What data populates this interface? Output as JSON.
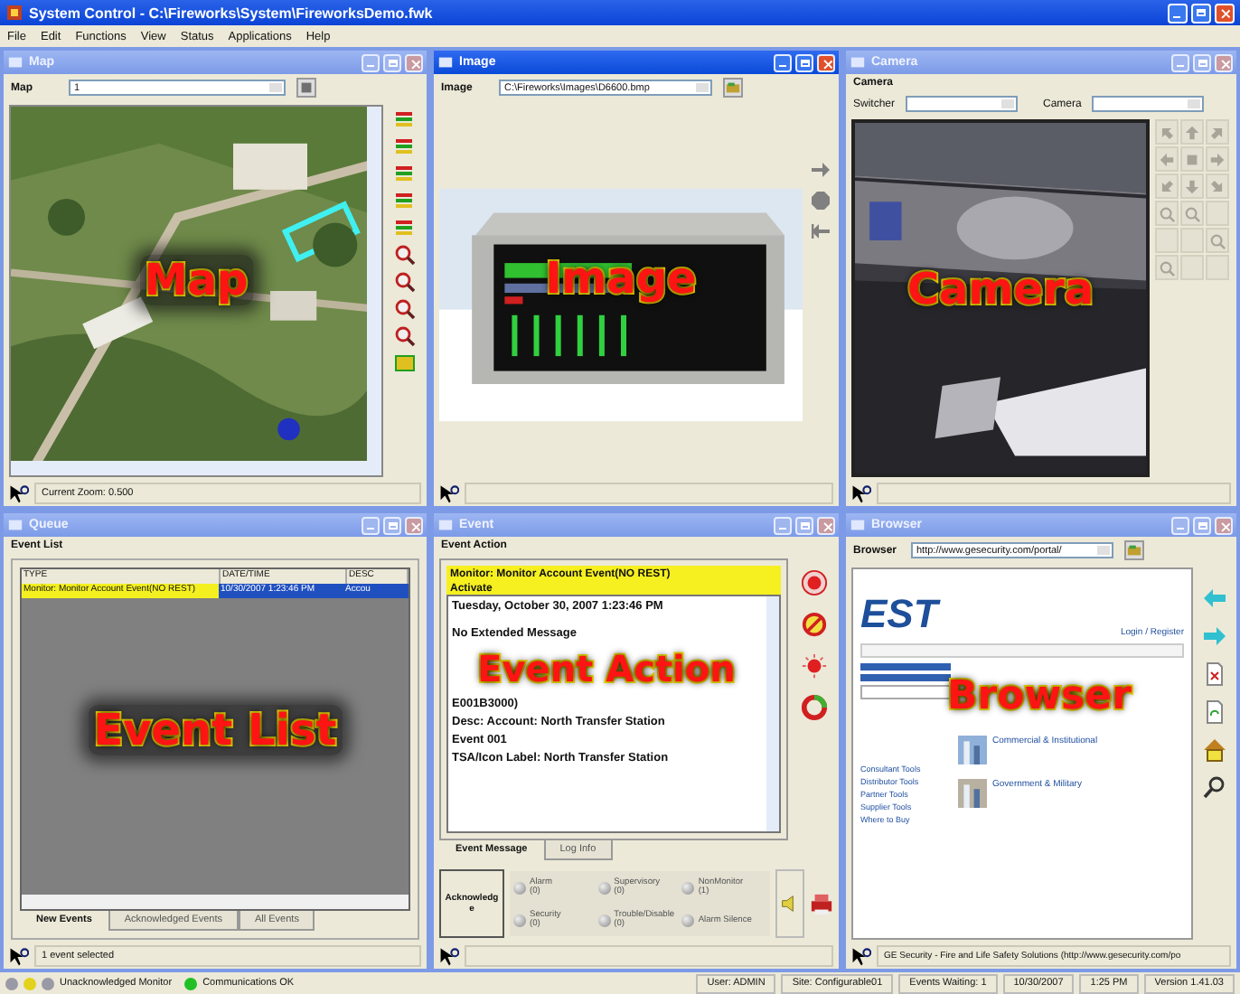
{
  "window": {
    "title": "System Control - C:\\Fireworks\\System\\FireworksDemo.fwk"
  },
  "menu": [
    "File",
    "Edit",
    "Functions",
    "View",
    "Status",
    "Applications",
    "Help"
  ],
  "map": {
    "title": "Map",
    "active": false,
    "label": "Map",
    "value": "1",
    "status": "Current Zoom: 0.500",
    "overlay": "Map"
  },
  "image": {
    "title": "Image",
    "active": true,
    "label": "Image",
    "value": "C:\\Fireworks\\Images\\D6600.bmp",
    "overlay": "Image"
  },
  "camera": {
    "title": "Camera",
    "active": false,
    "section": "Camera",
    "switcher_label": "Switcher",
    "camera_label": "Camera",
    "overlay": "Camera"
  },
  "queue": {
    "title": "Queue",
    "active": false,
    "section": "Event List",
    "columns": [
      "TYPE",
      "DATE/TIME",
      "DESC"
    ],
    "rows": [
      {
        "cells": [
          "Monitor: Monitor Account Event(NO REST)",
          "10/30/2007 1:23:46 PM",
          "Accou"
        ],
        "selected": true
      }
    ],
    "tabs": [
      {
        "label": "New Events",
        "selected": true
      },
      {
        "label": "Acknowledged Events",
        "selected": false
      },
      {
        "label": "All Events",
        "selected": false
      }
    ],
    "status": "1 event selected",
    "overlay": "Event List"
  },
  "event": {
    "title": "Event",
    "active": false,
    "section": "Event Action",
    "header": [
      "Monitor: Monitor Account Event(NO REST)",
      "Activate"
    ],
    "lines": [
      "Tuesday, October 30, 2007 1:23:46 PM",
      "No Extended Message",
      "E001B3000)",
      "Desc: Account: North Transfer Station",
      "Event 001",
      "TSA/Icon Label: North Transfer Station"
    ],
    "tabs": [
      {
        "label": "Event Message",
        "selected": true
      },
      {
        "label": "Log Info",
        "selected": false
      }
    ],
    "acknowledge": "Acknowledge",
    "indicators": [
      {
        "label": "Alarm",
        "count": "(0)"
      },
      {
        "label": "Supervisory",
        "count": "(0)"
      },
      {
        "label": "NonMonitor",
        "count": "(1)"
      },
      {
        "label": "Security",
        "count": "(0)"
      },
      {
        "label": "Trouble/Disable",
        "count": "(0)"
      },
      {
        "label": "Alarm Silence"
      }
    ],
    "overlay": "Event Action"
  },
  "browser": {
    "title": "Browser",
    "active": false,
    "label": "Browser",
    "url": "http://www.gesecurity.com/portal/",
    "page": {
      "logo": "EST",
      "login": "Login / Register",
      "links": [
        "Consultant Tools",
        "Distributor Tools",
        "Partner Tools",
        "Supplier Tools",
        "Where to Buy"
      ],
      "articles": [
        "Commercial & Institutional",
        "Government & Military"
      ]
    },
    "status": "GE Security - Fire and Life Safety Solutions (http://www.gesecurity.com/po",
    "overlay": "Browser"
  },
  "status_bar": {
    "indicators": [
      {
        "color": "#9a9aa6"
      },
      {
        "color": "#e2d21e"
      },
      {
        "color": "#9a9aa6",
        "label": "Unacknowledged Monitor"
      },
      {
        "color": "#22c022",
        "label": "Communications OK"
      }
    ],
    "cells": [
      "User: ADMIN",
      "Site: Configurable01",
      "Events Waiting: 1",
      "10/30/2007",
      "1:25 PM",
      "Version 1.41.03"
    ]
  }
}
